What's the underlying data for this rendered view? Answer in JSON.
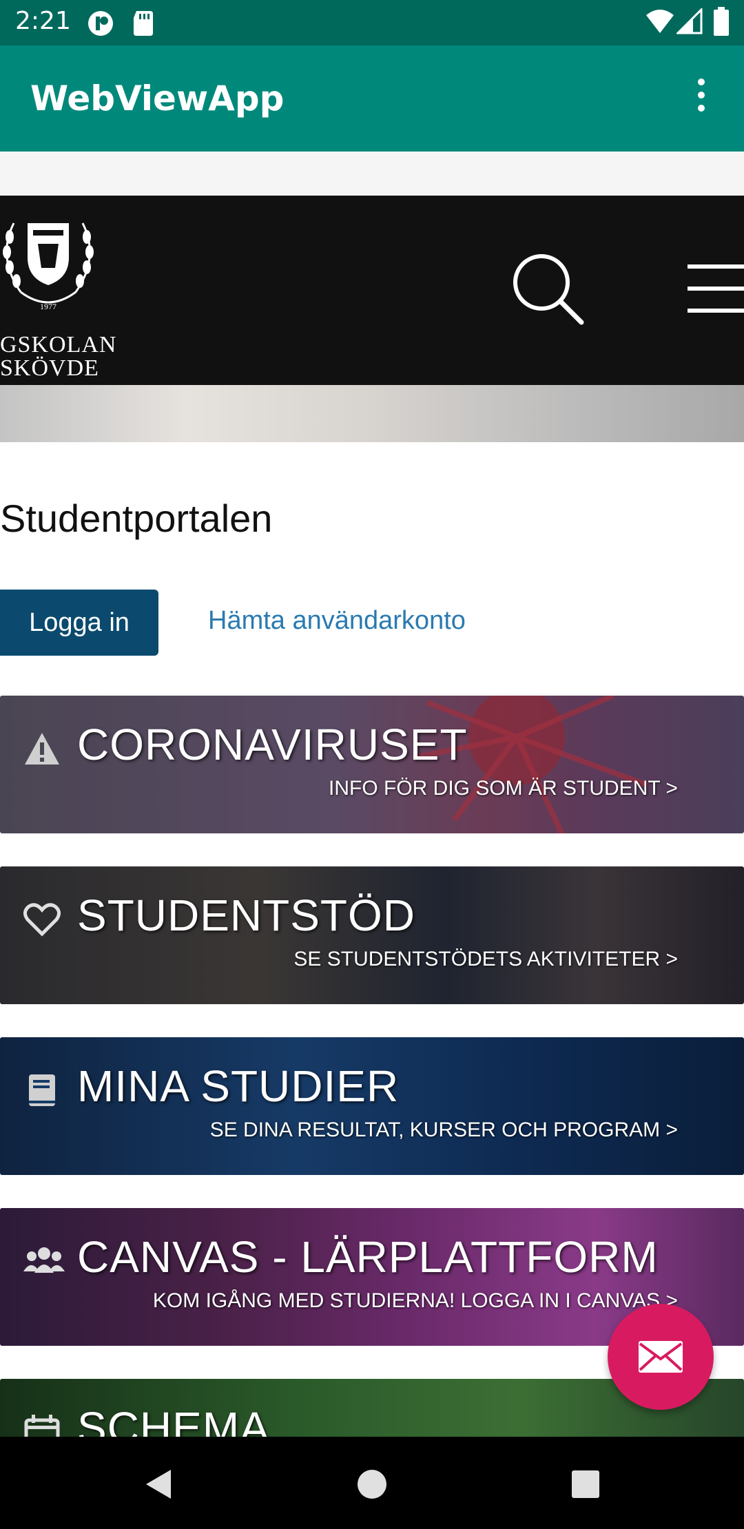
{
  "status_bar": {
    "time": "2:21",
    "icons": [
      "notification-icon",
      "sd-card-icon",
      "wifi-icon",
      "cell-signal-icon",
      "battery-icon"
    ]
  },
  "app_bar": {
    "title": "WebViewApp",
    "overflow_icon": "more-vert-icon",
    "color": "#00897b"
  },
  "site_header": {
    "logo_year": "1977",
    "logo_line1": "GSKOLAN",
    "logo_line2": "SKÖVDE",
    "search_icon": "search-icon",
    "menu_icon": "hamburger-menu-icon"
  },
  "portal": {
    "title": "Studentportalen",
    "login_label": "Logga in",
    "account_link": "Hämta användarkonto"
  },
  "banners": [
    {
      "icon": "warning-icon",
      "title": "CORONAVIRUSET",
      "subtitle": "INFO FÖR DIG SOM ÄR STUDENT >"
    },
    {
      "icon": "heart-icon",
      "title": "STUDENTSTÖD",
      "subtitle": "SE STUDENTSTÖDETS AKTIVITETER >"
    },
    {
      "icon": "book-icon",
      "title": "MINA STUDIER",
      "subtitle": "SE DINA RESULTAT, KURSER OCH PROGRAM >"
    },
    {
      "icon": "users-icon",
      "title": "CANVAS - LÄRPLATTFORM",
      "subtitle": "KOM IGÅNG MED STUDIERNA! LOGGA IN I CANVAS >"
    },
    {
      "icon": "calendar-icon",
      "title": "SCHEMA",
      "subtitle": ""
    }
  ],
  "fab": {
    "icon": "mail-icon",
    "color": "#d81b60"
  },
  "nav_bar": {
    "icons": [
      "back-icon",
      "home-icon",
      "recents-icon"
    ]
  }
}
